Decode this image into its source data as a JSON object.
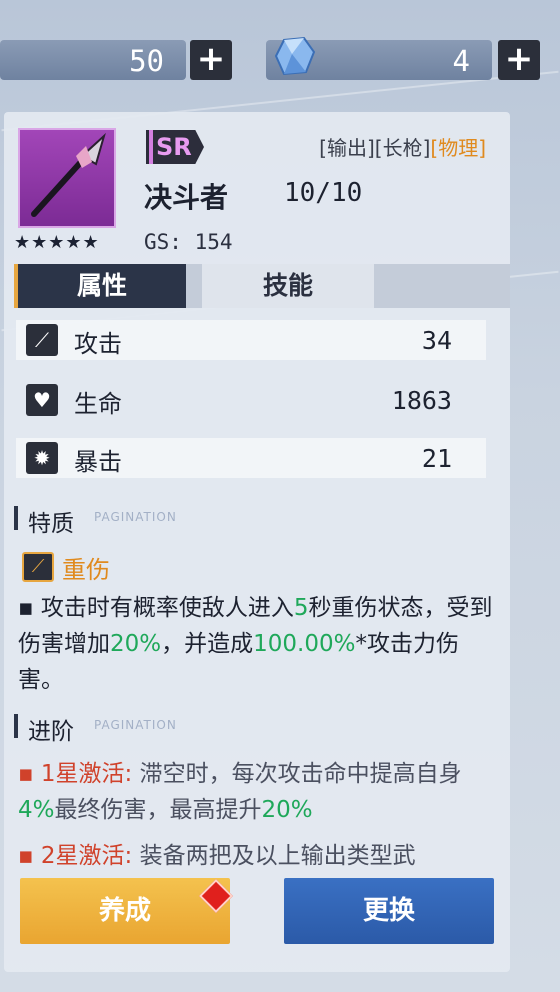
{
  "currency": {
    "stamina_value": "50",
    "gem_value": "4",
    "plus_label": "+"
  },
  "weapon": {
    "rarity": "SR",
    "tags": [
      "[输出]",
      "[长枪]",
      "[物理]"
    ],
    "name": "决斗者",
    "level": "10/10",
    "stars": "★★★★★",
    "gs": "GS: 154"
  },
  "tabs": {
    "attributes": "属性",
    "skills": "技能"
  },
  "stats": [
    {
      "label": "攻击",
      "value": "34",
      "icon": "sword-icon"
    },
    {
      "label": "生命",
      "value": "1863",
      "icon": "heart-icon"
    },
    {
      "label": "暴击",
      "value": "21",
      "icon": "burst-icon"
    }
  ],
  "trait": {
    "section_title": "特质",
    "pagination_label": "PAGINATION",
    "name": "重伤",
    "desc": {
      "p1": "▪ 攻击时有概率使敌人进入",
      "v1": "5",
      "p2": "秒重伤状态，受到伤害增加",
      "v2": "20%",
      "p3": "，并造成",
      "v3": "100.00%",
      "p4": "*攻击力伤害。"
    }
  },
  "advance": {
    "section_title": "进阶",
    "pagination_label": "PAGINATION",
    "items": [
      {
        "label": "1星激活:",
        "text1": " 滞空时，每次攻击命中提高自身",
        "v1": "4%",
        "text2": "最终伤害，最高提升",
        "v2": "20%"
      },
      {
        "label": "2星激活:",
        "text1": " 装备两把及以上输出类型武"
      }
    ]
  },
  "buttons": {
    "develop": "养成",
    "replace": "更换"
  },
  "colors": {
    "accent_orange": "#e08a1e",
    "value_green": "#1fa85a",
    "star_red": "#d0422b",
    "rarity_purple": "#a246b8"
  }
}
